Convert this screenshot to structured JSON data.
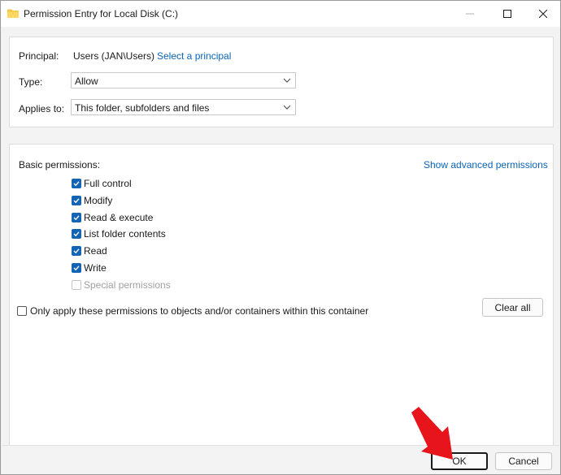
{
  "window": {
    "title": "Permission Entry for Local Disk (C:)"
  },
  "titlebar_icons": [
    "folder-icon",
    "minimize-icon",
    "maximize-icon",
    "close-icon"
  ],
  "principal": {
    "label": "Principal:",
    "value": "Users (JAN\\Users)",
    "link": "Select a principal"
  },
  "type": {
    "label": "Type:",
    "value": "Allow"
  },
  "applies_to": {
    "label": "Applies to:",
    "value": "This folder, subfolders and files"
  },
  "basic_permissions": {
    "label": "Basic permissions:",
    "advanced_link": "Show advanced permissions",
    "items": [
      {
        "label": "Full control",
        "checked": true,
        "enabled": true
      },
      {
        "label": "Modify",
        "checked": true,
        "enabled": true
      },
      {
        "label": "Read & execute",
        "checked": true,
        "enabled": true
      },
      {
        "label": "List folder contents",
        "checked": true,
        "enabled": true
      },
      {
        "label": "Read",
        "checked": true,
        "enabled": true
      },
      {
        "label": "Write",
        "checked": true,
        "enabled": true
      },
      {
        "label": "Special permissions",
        "checked": false,
        "enabled": false
      }
    ]
  },
  "only_apply": {
    "label": "Only apply these permissions to objects and/or containers within this container",
    "checked": false
  },
  "buttons": {
    "clear_all": "Clear all",
    "ok": "OK",
    "cancel": "Cancel"
  },
  "colors": {
    "accent": "#1464b4",
    "link": "#0b64b8",
    "annotation_arrow": "#e8141c"
  }
}
